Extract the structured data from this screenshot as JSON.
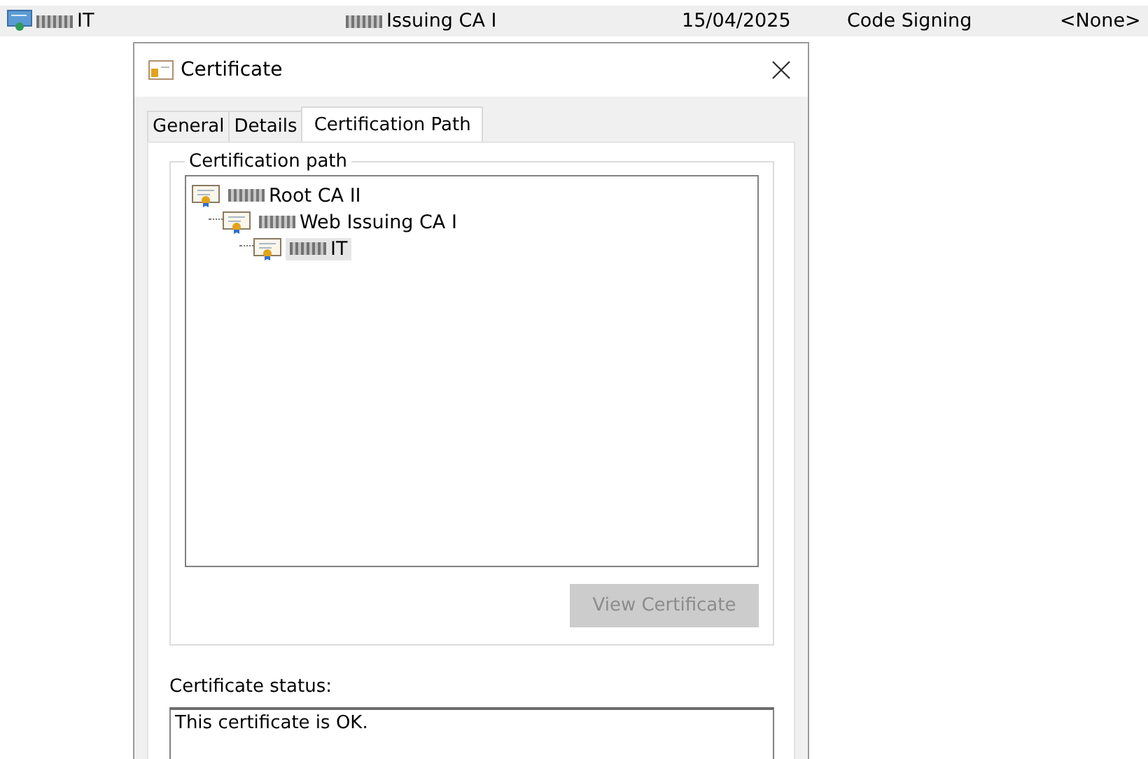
{
  "background_row": {
    "name": "IT",
    "issuer": "Issuing CA I",
    "expiration": "15/04/2025",
    "purpose": "Code Signing",
    "friendly_name": "<None>"
  },
  "dialog": {
    "title": "Certificate",
    "tabs": [
      {
        "label": "General",
        "selected": false
      },
      {
        "label": "Details",
        "selected": false
      },
      {
        "label": "Certification Path",
        "selected": true
      }
    ],
    "path_group": {
      "label": "Certification path",
      "tree": [
        {
          "label": "Root CA II",
          "selected": false,
          "children": [
            {
              "label": "Web Issuing CA I",
              "selected": false,
              "children": [
                {
                  "label": "IT",
                  "selected": true
                }
              ]
            }
          ]
        }
      ]
    },
    "view_button": {
      "label": "View Certificate",
      "disabled": true
    },
    "status": {
      "label": "Certificate status:",
      "value": "This certificate is OK."
    }
  }
}
